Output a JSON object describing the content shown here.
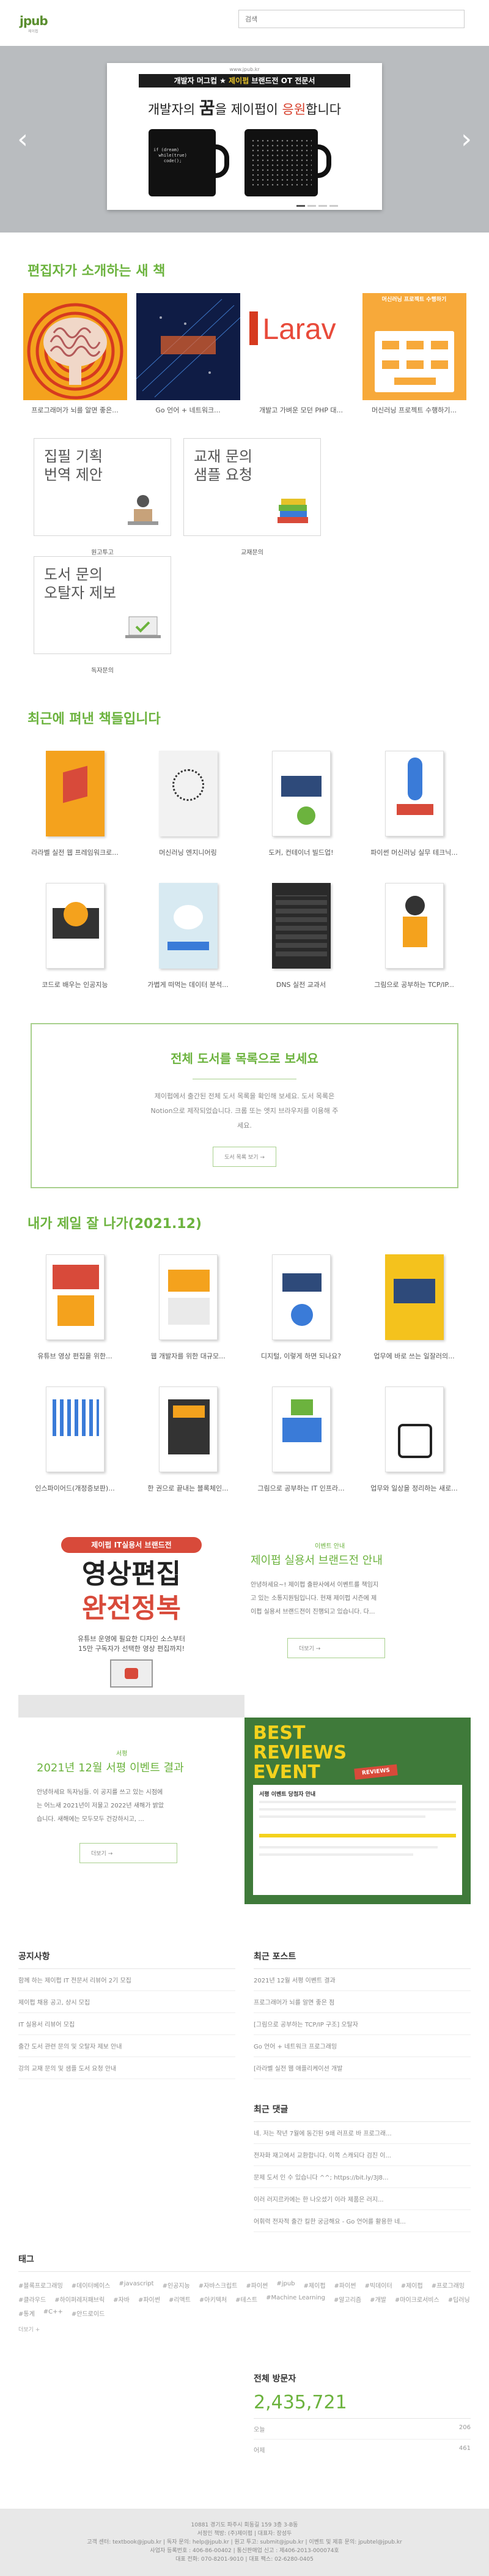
{
  "header": {
    "logo_text": "jpub",
    "logo_sub": "제이펍",
    "search_placeholder": "검색"
  },
  "slider": {
    "top_line": "www.jpub.kr",
    "ribbon_a": "개발자 머그컵",
    "ribbon_plus": " ★ ",
    "ribbon_b": "제이펍",
    "ribbon_c": " 브랜드전 OT 전문서",
    "headline_a": "개발자의 ",
    "headline_big": "꿈",
    "headline_b": "을 제이펍이 ",
    "headline_red": "응원",
    "headline_c": "합니다",
    "mug_code": "if (dream)\n  while(true)\n    code();",
    "prev": "‹",
    "next": "›"
  },
  "new_books": {
    "title": "편집자가 소개하는 새 책",
    "items": [
      {
        "caption": "프로그래머가 뇌를 알면 좋은..."
      },
      {
        "caption": "Go 언어 + 네트워크..."
      },
      {
        "caption": "개발고 가벼운 모던 PHP 대..."
      },
      {
        "caption": "머신러닝 프로젝트 수행하기..."
      }
    ],
    "laravel_text": "Larav",
    "ml_text": "머신러닝 프로젝트 수행하기"
  },
  "contact": {
    "items": [
      {
        "title_a": "집필 기획",
        "title_b": "번역 제안",
        "caption": "원고투고"
      },
      {
        "title_a": "교재 문의",
        "title_b": "샘플 요청",
        "caption": "교재문의"
      },
      {
        "title_a": "도서 문의",
        "title_b": "오탈자 제보",
        "caption": "독자문의"
      }
    ]
  },
  "recent": {
    "title": "최근에 펴낸 책들입니다",
    "row1": [
      {
        "caption": "라라벨 실전 웹 프레임워크로..."
      },
      {
        "caption": "머신러닝 엔지니어링"
      },
      {
        "caption": "도커, 컨테이너 빌드업!"
      },
      {
        "caption": "파이썬 머신러닝 실무 테크닉..."
      }
    ],
    "row2": [
      {
        "caption": "코드로 배우는 인공지능"
      },
      {
        "caption": "가볍게 떠먹는 데이터 분석..."
      },
      {
        "caption": "DNS 실전 교과서"
      },
      {
        "caption": "그림으로 공부하는 TCP/IP..."
      }
    ]
  },
  "catalog": {
    "title": "전체 도서를 목록으로 보세요",
    "line1": "제이펍에서 출간된 전체 도서 목록을 확인해 보세요. 도서 목록은",
    "line2": "Notion으로 제작되었습니다. 크롬 또는 엣지 브라우저를 이용해 주",
    "line3": "세요.",
    "button": "도서 목록 보기 →"
  },
  "best": {
    "title": "내가 제일 잘 나가(2021.12)",
    "row1": [
      {
        "caption": "유튜브 영상 편집을 위한..."
      },
      {
        "caption": "웹 개발자를 위한 대규모..."
      },
      {
        "caption": "디지털, 이렇게 하면 되나요?"
      },
      {
        "caption": "업무에 바로 쓰는 일잘러의..."
      }
    ],
    "row2": [
      {
        "caption": "인스파이어드(개정증보판)..."
      },
      {
        "caption": "한 권으로 끝내는 블록체인..."
      },
      {
        "caption": "그림으로 공부하는 IT 인프라..."
      },
      {
        "caption": "업무와 일상을 정리하는 새로..."
      }
    ]
  },
  "event1": {
    "banner_label": "제이펍 IT실용서 브랜드전",
    "banner_line1": "영상편집",
    "banner_line2": "완전정복",
    "banner_sub1": "유튜브 운영에 필요한 디자인 소스부터",
    "banner_sub2": "15만 구독자가 선택한 영상 편집까지!",
    "kicker": "이벤트 안내",
    "title": "제이펍 실용서 브랜드전 안내",
    "text1": "안녕하세요~! 제이펍 출판사에서 이벤트를 책임지",
    "text2": "고 있는 소통지원팀입니다. 현재 제이펍 시즌에 제",
    "text3": "이펍 실용서 브랜드전이 진행되고 있습니다. 다...",
    "button": "더보기 →"
  },
  "event2": {
    "kicker": "서평",
    "title": "2021년 12월 서평 이벤트 결과",
    "text1": "안녕하세요 독자님들. 이 공지를 쓰고 있는 시점에",
    "text2": "는 어느새 2021년이 저물고 2022년 새해가 밝았",
    "text3": "습니다. 새해에는 모두모두 건강하시고, ...",
    "button": "더보기 →",
    "banner_line1": "BEST",
    "banner_line2": "REVIEWS",
    "banner_line3": "EVENT",
    "banner_tag": "REVIEWS",
    "banner_caption": "서평 이벤트 당첨자 안내"
  },
  "notice": {
    "title": "공지사항",
    "items": [
      "함께 하는 제이펍 IT 전문서 리뷰어 2기 모집",
      "제이펍 채용 공고, 상시 모집",
      "IT 실용서 리뷰어 모집",
      "출간 도서 관련 문의 및 오탈자 제보 안내",
      "강의 교재 문의 및 샘플 도서 요청 안내"
    ]
  },
  "recent_posts": {
    "title": "최근 포스트",
    "items": [
      "2021년 12월 서평 이벤트 결과",
      "프로그래머가 뇌를 알면 좋은 점",
      "[그림으로 공부하는 TCP/IP 구조] 오탈자",
      "Go 언어 + 네트워크 프로그래밍",
      "[라라벨 실전 웹 애플리케이션 개발"
    ]
  },
  "recent_comments": {
    "title": "최근 댓글",
    "items": [
      "네. 저는 작년 7월에 동긴된 9쇄 러프로 바 프로그래...",
      "전자화 재고에서 교환합니다. 이쪽 스캐되다 검진 이...",
      "문제 도서 인 수 있습니다 ^^; https://bit.ly/3J8...",
      "이러 러지르카에는 한 나오셨기 이라 제품은 러지...",
      "어휘력 전자적 출간 킬한 궁금해요 - Go 언어를 활용한 네..."
    ]
  },
  "tags": {
    "title": "태그",
    "items": [
      "#블록프로그래밍",
      "#데이터베이스",
      "#javascript",
      "#인공지능",
      "#자바스크립트",
      "#파이썬",
      "#jpub",
      "#제이펍",
      "#파이썬",
      "#빅데이터",
      "#제이펍",
      "#프로그래밍",
      "#클라우드",
      "#하이퍼레저패브릭",
      "#자바",
      "#파이썬",
      "#리액트",
      "#아키텍처",
      "#테스트",
      "#Machine Learning",
      "#알고리즘",
      "#개발",
      "#마이크로서비스",
      "#딥러닝",
      "#통계",
      "#C++",
      "#안드로이드"
    ],
    "more": "더보기 +"
  },
  "visitors": {
    "title": "전체 방문자",
    "total": "2,435,721",
    "today_label": "오늘",
    "today_value": "206",
    "yesterday_label": "어제",
    "yesterday_value": "461"
  },
  "footer": {
    "line1": "10881 경기도 파주시 회동길 159 3층 3-B동 ",
    "line2": "서정인 책방: (주)제이펍 | 대표자: 장성두",
    "line3": "고객 센터: textbook@jpub.kr | 독자 문의: help@jpub.kr | 원고 투고: submit@jpub.kr | 이벤트 및 제휴 문의: jpubtel@jpub.kr",
    "line4": "사업자 등록번호 : 406-86-00402 | 통신판매업 신고 : 제406-2013-000074호",
    "line5": "대표 전화: 070-8201-9010 | 대표 팩스: 02-6280-0405"
  },
  "colors": {
    "accent": "#6cb33e",
    "accent_light": "#a8d08d"
  }
}
